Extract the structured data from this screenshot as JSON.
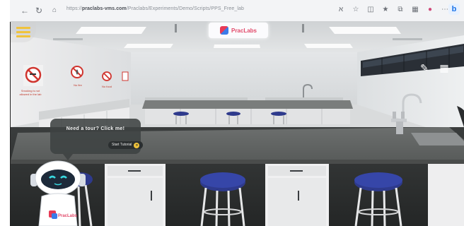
{
  "browser": {
    "url_host": "praclabs-vms.com",
    "url_path": "/Praclabs/Experiments/Demo/Scripts/PPS_Free_lab",
    "url_prefix": "https://"
  },
  "overlay": {
    "brand_name": "PracLabs",
    "bubble_text": "Need a tour? Click me!",
    "tutorial_button_label": "Start Tutorial",
    "robot_brand": "PracLabs"
  },
  "signs": [
    {
      "icon": "no-smoking-icon",
      "label": "Smoking is not allowed in the lab"
    },
    {
      "icon": "no-fire-icon",
      "label": "No fire"
    },
    {
      "icon": "no-food-icon",
      "label": "No food"
    }
  ],
  "colors": {
    "accent": "#f0c33b",
    "brand_pink": "#e24a6a",
    "brand_blue": "#3b7be8",
    "stool_blue": "#2e3a8c",
    "bench_top": "#5f6260"
  }
}
